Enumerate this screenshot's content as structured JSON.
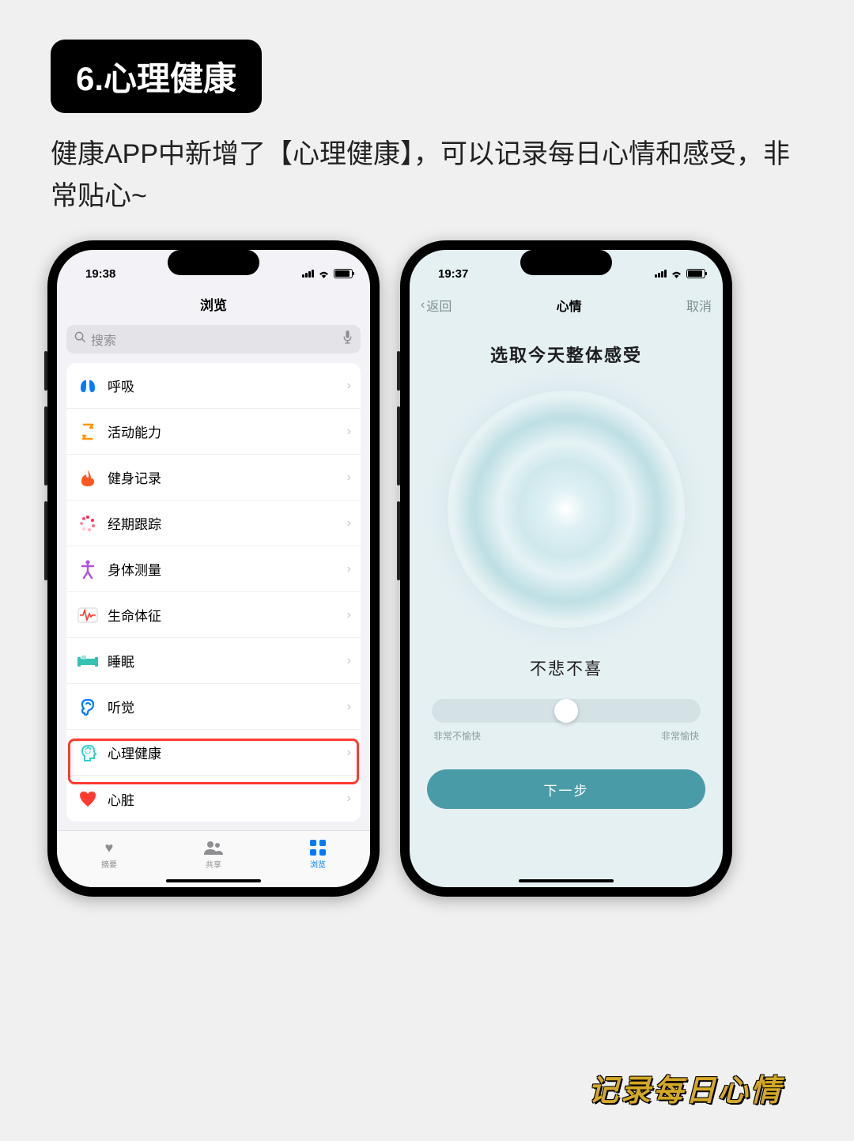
{
  "sectionTitle": "6.心理健康",
  "description": "健康APP中新增了【心理健康】，可以记录每日心情和感受，非常贴心~",
  "caption": "记录每日心情",
  "leftPhone": {
    "time": "19:38",
    "navTitle": "浏览",
    "searchPlaceholder": "搜索",
    "categories": [
      {
        "icon": "lungs-icon",
        "label": "呼吸",
        "color": "#007aff"
      },
      {
        "icon": "mobility-icon",
        "label": "活动能力",
        "color": "#ff9500"
      },
      {
        "icon": "flame-icon",
        "label": "健身记录",
        "color": "#ff3b30"
      },
      {
        "icon": "cycle-icon",
        "label": "经期跟踪",
        "color": "#ff2d55"
      },
      {
        "icon": "body-icon",
        "label": "身体测量",
        "color": "#af52de"
      },
      {
        "icon": "vitals-icon",
        "label": "生命体征",
        "color": "#ff3b30"
      },
      {
        "icon": "sleep-icon",
        "label": "睡眠",
        "color": "#34c2b3"
      },
      {
        "icon": "hearing-icon",
        "label": "听觉",
        "color": "#007aff"
      },
      {
        "icon": "mental-icon",
        "label": "心理健康",
        "color": "#32d0c8"
      },
      {
        "icon": "heart-icon",
        "label": "心脏",
        "color": "#ff3b30"
      }
    ],
    "tabs": [
      {
        "label": "摘要",
        "active": false
      },
      {
        "label": "共享",
        "active": false
      },
      {
        "label": "浏览",
        "active": true
      }
    ]
  },
  "rightPhone": {
    "time": "19:37",
    "backLabel": "返回",
    "navTitle": "心情",
    "cancelLabel": "取消",
    "heading": "选取今天整体感受",
    "moodLevel": "不悲不喜",
    "sliderMin": "非常不愉快",
    "sliderMax": "非常愉快",
    "nextButton": "下一步"
  }
}
